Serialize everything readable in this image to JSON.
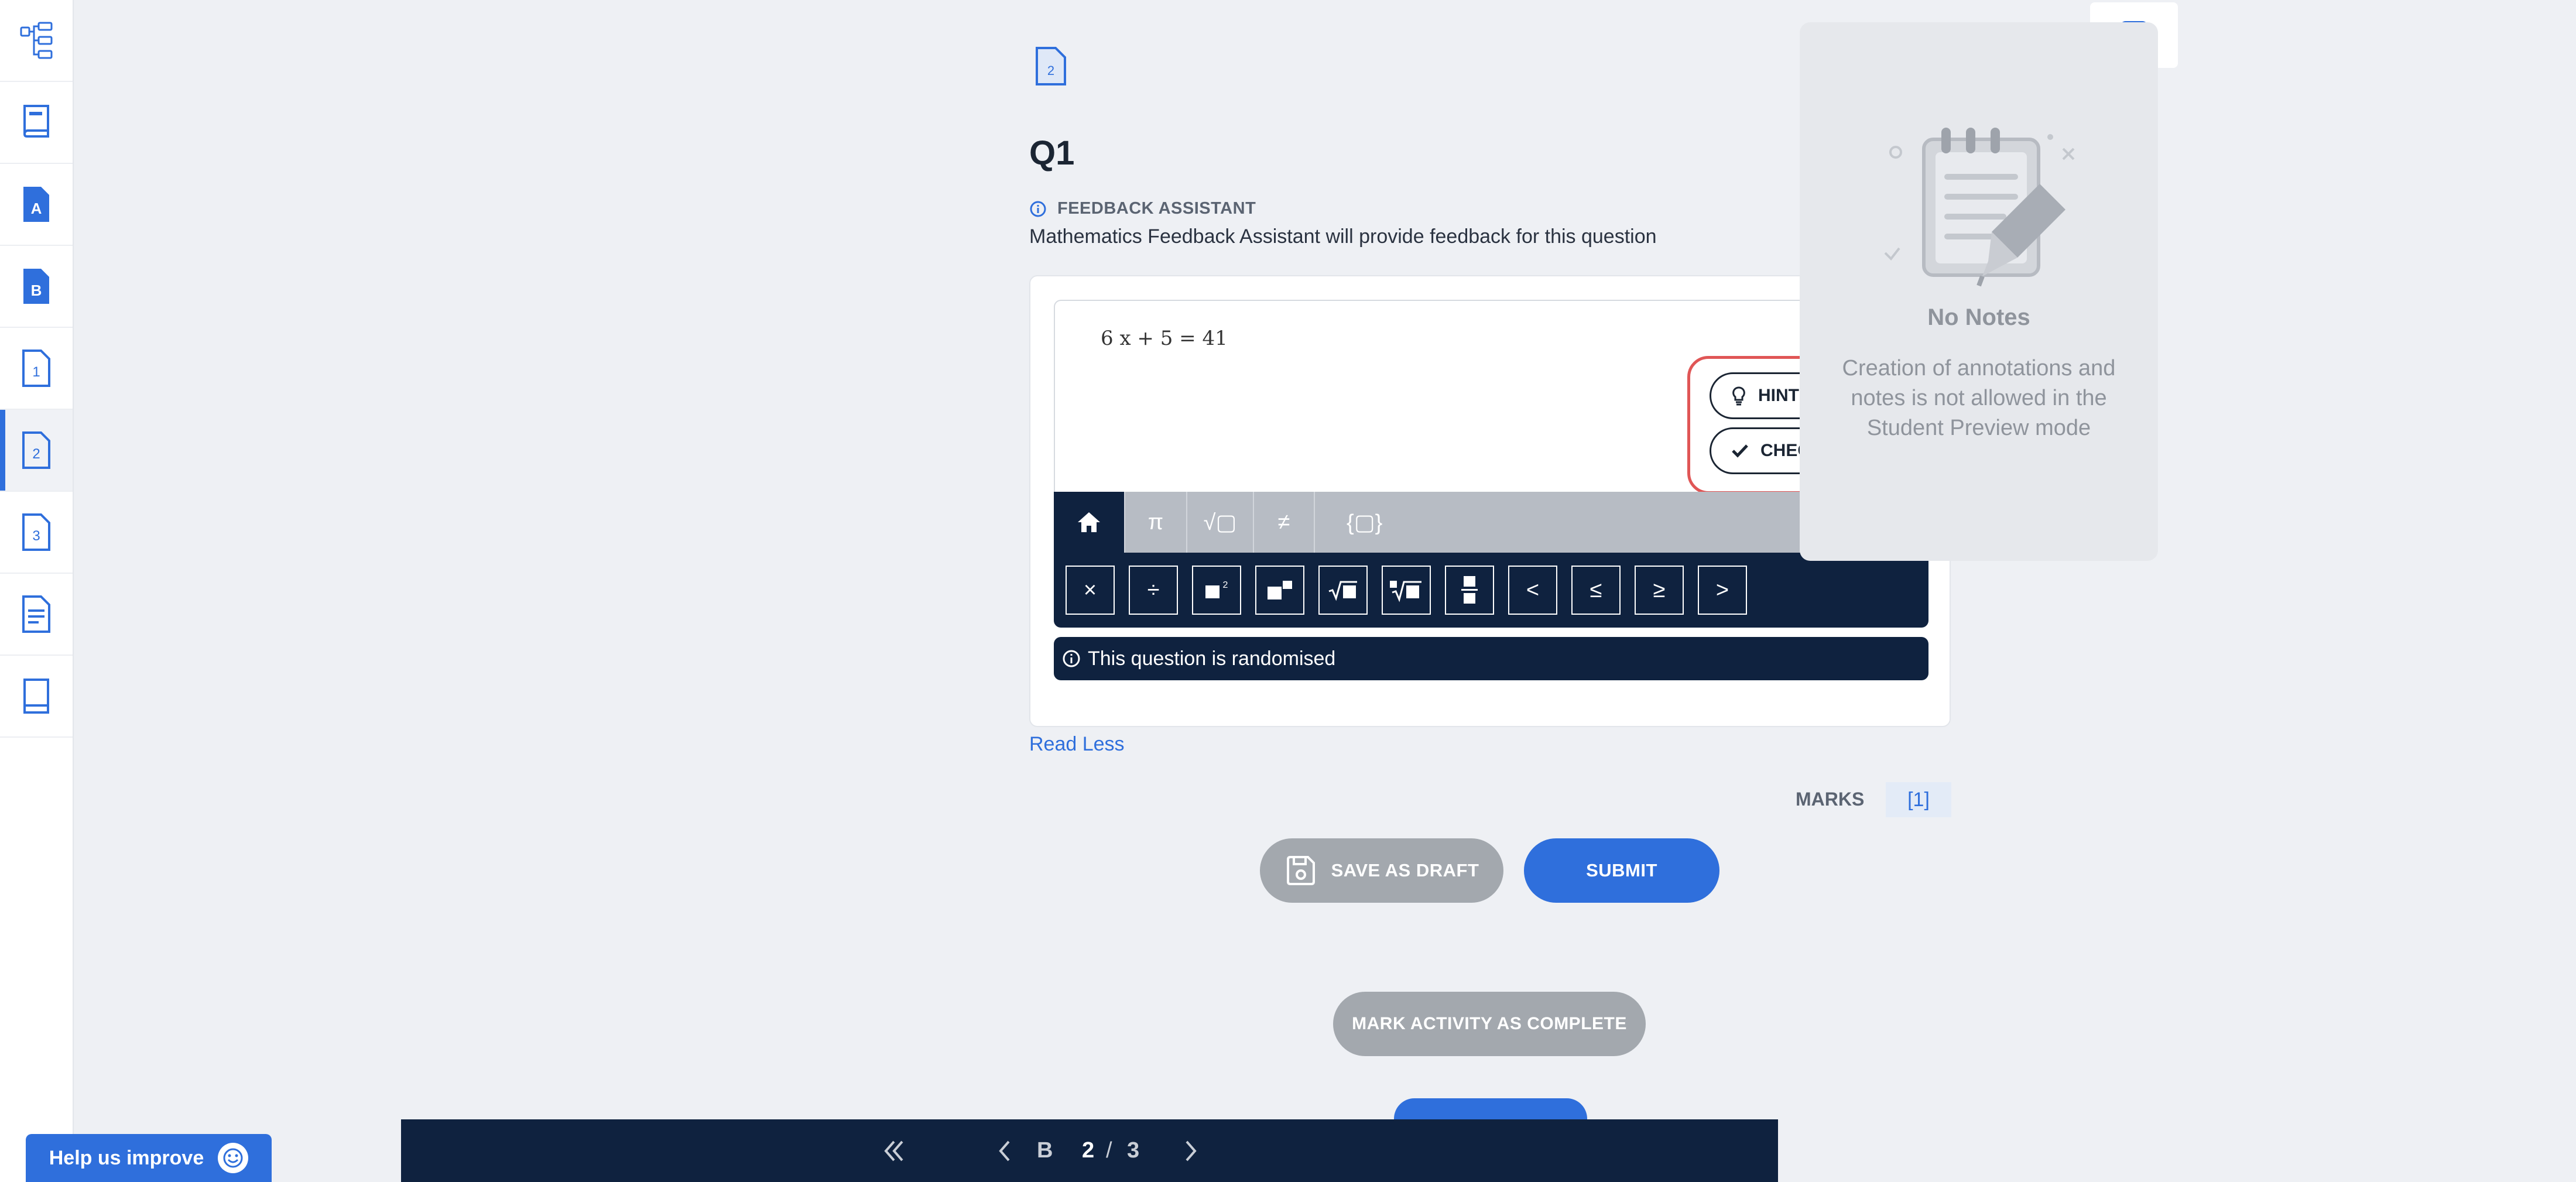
{
  "sidebar": {
    "items": [
      {
        "name": "structure-icon"
      },
      {
        "name": "book-icon"
      },
      {
        "name": "section-a-icon",
        "label": "A"
      },
      {
        "name": "section-b-icon",
        "label": "B"
      },
      {
        "name": "page-1-icon",
        "label": "1"
      },
      {
        "name": "page-2-icon",
        "label": "2",
        "active": true
      },
      {
        "name": "page-3-icon",
        "label": "3"
      },
      {
        "name": "document-icon"
      },
      {
        "name": "notebook-icon"
      }
    ]
  },
  "help": {
    "label": "Help us improve"
  },
  "page_icon_label": "2",
  "question": {
    "title": "Q1",
    "feedback_label": "FEEDBACK ASSISTANT",
    "feedback_desc": "Mathematics Feedback Assistant will provide feedback for this question",
    "expression": "6 x + 5 = 41",
    "hint_label": "HINT",
    "check_label": "CHECK",
    "toolbar_tabs": [
      "home",
      "π",
      "√▢",
      "≠",
      "{▢}"
    ],
    "keys": [
      "×",
      "÷",
      "▢²",
      "▢▢",
      "√▢",
      "∛▢",
      "▢/▢",
      "<",
      "≤",
      "≥",
      ">"
    ],
    "randomised_text": "This question is randomised"
  },
  "read_less": "Read Less",
  "marks": {
    "label": "MARKS",
    "value": "[1]"
  },
  "buttons": {
    "save_draft": "SAVE AS DRAFT",
    "submit": "SUBMIT",
    "mark_complete": "MARK ACTIVITY AS COMPLETE"
  },
  "nav": {
    "section": "B",
    "page": "2",
    "separator": "/",
    "total": "3"
  },
  "notes": {
    "title": "No Notes",
    "text": "Creation of annotations and notes is not allowed in the Student Preview mode"
  },
  "colors": {
    "accent": "#2f6fdc",
    "navy": "#0f223f",
    "highlight": "#e05656"
  }
}
